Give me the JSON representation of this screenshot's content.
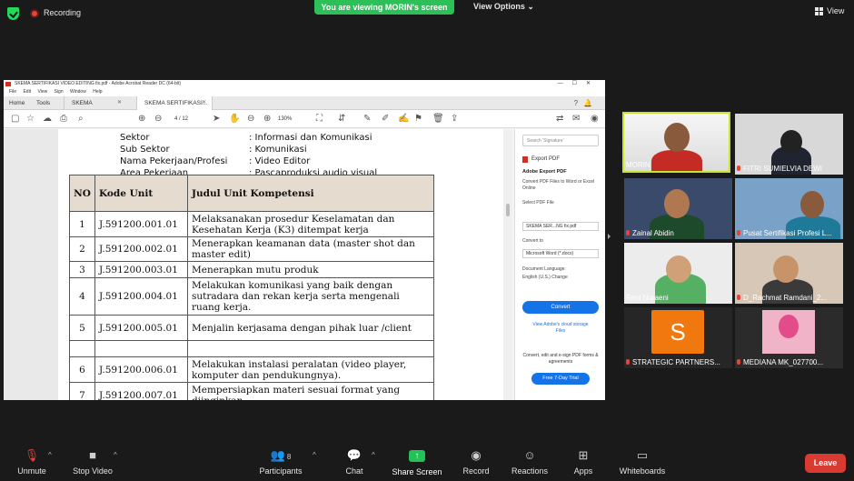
{
  "top": {
    "recording_label": "Recording",
    "viewing_banner": "You are viewing MORIN's screen",
    "view_options": "View Options ⌄",
    "view_label": "View"
  },
  "acrobat": {
    "title": "SKEMA SERTIFIKASI VIDEO EDITING fix.pdf - Adobe Acrobat Reader DC (64-bit)",
    "menu": [
      "File",
      "Edit",
      "View",
      "Sign",
      "Window",
      "Help"
    ],
    "tabs": {
      "home": "Home",
      "tools": "Tools",
      "tab1": "SKEMA SERTIFIKASI...",
      "tab2": "SKEMA SERTIFIKASI..."
    },
    "page_indicator": "4 / 12",
    "zoom": "130%"
  },
  "document": {
    "info": [
      {
        "label": "Sektor",
        "value": ": Informasi dan Komunikasi"
      },
      {
        "label": "Sub Sektor",
        "value": ": Komunikasi"
      },
      {
        "label": "Nama Pekerjaan/Profesi",
        "value": ": Video Editor"
      },
      {
        "label": "Area Pekerjaan",
        "value": ": Pascaproduksi audio visual"
      }
    ],
    "headers": {
      "no": "NO",
      "kode": "Kode Unit",
      "judul": "Judul Unit Kompetensi"
    },
    "rows": [
      {
        "no": "1",
        "kode": "J.591200.001.01",
        "judul": "Melaksanakan prosedur Keselamatan dan Kesehatan Kerja (K3) ditempat kerja"
      },
      {
        "no": "2",
        "kode": "J.591200.002.01",
        "judul": "Menerapkan keamanan data (master shot dan master edit)"
      },
      {
        "no": "3",
        "kode": "J.591200.003.01",
        "judul": "Menerapkan mutu produk"
      },
      {
        "no": "4",
        "kode": "J.591200.004.01",
        "judul": "Melakukan komunikasi yang baik dengan sutradara dan rekan kerja serta mengenali ruang kerja."
      },
      {
        "no": "5",
        "kode": "J.591200.005.01",
        "judul": "Menjalin kerjasama dengan pihak luar /client"
      },
      {
        "no": "",
        "kode": "",
        "judul": ""
      },
      {
        "no": "6",
        "kode": "J.591200.006.01",
        "judul": "Melakukan instalasi peralatan (video player, komputer dan pendukungnya)."
      },
      {
        "no": "7",
        "kode": "J.591200.007.01",
        "judul": "Mempersiapkan materi sesuai format yang diinginkan."
      }
    ]
  },
  "pane": {
    "search_placeholder": "Search 'Signature'",
    "export_head": "Export PDF",
    "adobe_export": "Adobe Export PDF",
    "export_desc": "Convert PDF Files to Word or Excel Online",
    "select_label": "Select PDF File",
    "file_name": "SKEMA SER...NG fix.pdf",
    "convert_to": "Convert to",
    "convert_value": "Microsoft Word (*.docx)",
    "doc_language": "Document Language:",
    "language_value": "English (U.S.)  Change",
    "convert_btn": "Convert",
    "cloud_link": "View Adobe's cloud storage Files",
    "promo": "Convert, edit and e-sign PDF forms & agreements",
    "trial_btn": "Free 7-Day Trial"
  },
  "participants": [
    {
      "name": "MORIN"
    },
    {
      "name": "FITRI SUMIELVIA DEWI"
    },
    {
      "name": "Zainal Abidin"
    },
    {
      "name": "Pusat Sertifikasi Profesi L..."
    },
    {
      "name": "Reni Nuraeni"
    },
    {
      "name": "D_Rachmat Ramdani_2..."
    },
    {
      "name": "STRATEGIC PARTNERS..."
    },
    {
      "name": "MEDIANA MK_027700..."
    }
  ],
  "strategic_initial": "S",
  "toolbar": {
    "unmute": "Unmute",
    "stop_video": "Stop Video",
    "participants": "Participants",
    "participants_count": "8",
    "chat": "Chat",
    "share_screen": "Share Screen",
    "record": "Record",
    "reactions": "Reactions",
    "apps": "Apps",
    "whiteboards": "Whiteboards",
    "leave": "Leave"
  }
}
